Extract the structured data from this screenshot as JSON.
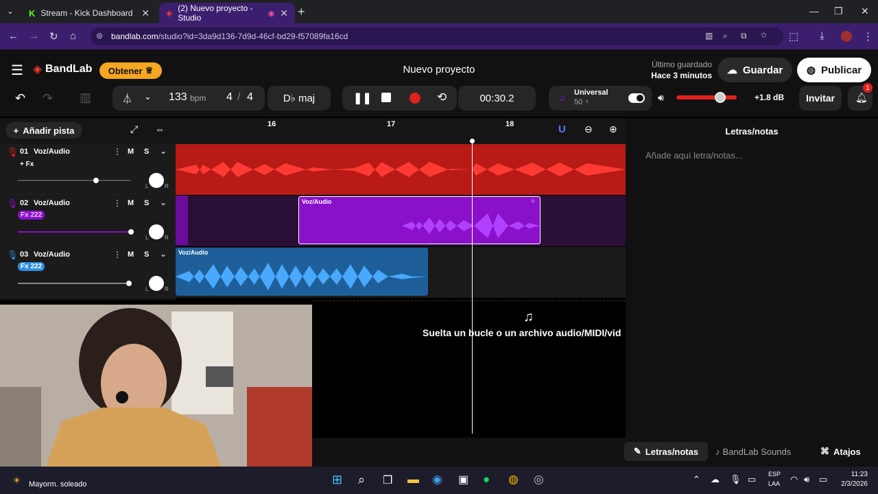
{
  "browser": {
    "tabs": [
      {
        "label": "Stream - Kick Dashboard"
      },
      {
        "label": "(2) Nuevo proyecto - Studio"
      }
    ],
    "url_domain": "bandlab.com",
    "url_path": "/studio?id=3da9d136-7d9d-46cf-bd29-f57089fa16cd"
  },
  "app": {
    "brand": "BandLab",
    "obtain_label": "Obtener",
    "project_title": "Nuevo proyecto",
    "last_saved_label": "Último guardado",
    "last_saved_time": "Hace 3 minutos",
    "save_label": "Guardar",
    "publish_label": "Publicar"
  },
  "toolbar": {
    "bpm_value": "133",
    "bpm_unit": "bpm",
    "time_sig_num": "4",
    "time_sig_sep": "/",
    "time_sig_den": "4",
    "key": "D♭ maj",
    "time_display": "00:30.2",
    "instrument_name": "Universal",
    "instrument_value": "50",
    "volume_db": "+1.8 dB",
    "invite_label": "Invitar",
    "notification_count": "1"
  },
  "tracks_panel": {
    "add_track_label": "Añadir pista",
    "ruler_marks": [
      "16",
      "17",
      "18"
    ],
    "tracks": [
      {
        "number": "01",
        "name": "Voz/Audio",
        "fx": "+ Fx",
        "mute": "M",
        "solo": "S",
        "pan_l": "L",
        "pan_r": "R",
        "color": "#e0201c"
      },
      {
        "number": "02",
        "name": "Voz/Audio",
        "fx": "Fx 222",
        "mute": "M",
        "solo": "S",
        "pan_l": "L",
        "pan_r": "R",
        "color": "#8a10c9"
      },
      {
        "number": "03",
        "name": "Voz/Audio",
        "fx": "Fx 222",
        "mute": "M",
        "solo": "S",
        "pan_l": "L",
        "pan_r": "R",
        "color": "#2f8fe0"
      }
    ],
    "clip_labels": [
      "Voz/Audio",
      "Voz/Audio"
    ],
    "drop_hint": "Suelta un bucle o un archivo audio/MIDI/vid"
  },
  "right_panel": {
    "title": "Letras/notas",
    "placeholder": "Añade aquí letra/notas..."
  },
  "bottom_bar": {
    "lyrics_tab": "Letras/notas",
    "sounds_tab": "BandLab Sounds",
    "shortcuts": "Atajos"
  },
  "taskbar": {
    "weather": "Mayorm. soleado",
    "lang_top": "ESP",
    "lang_bottom": "LAA",
    "time": "11:23",
    "date": "2/3/2026"
  },
  "colors": {
    "accent_orange": "#f5a623",
    "brand_red": "#ff3b30",
    "track1": "#e0201c",
    "track2": "#8a10c9",
    "track3": "#2f8fe0"
  }
}
